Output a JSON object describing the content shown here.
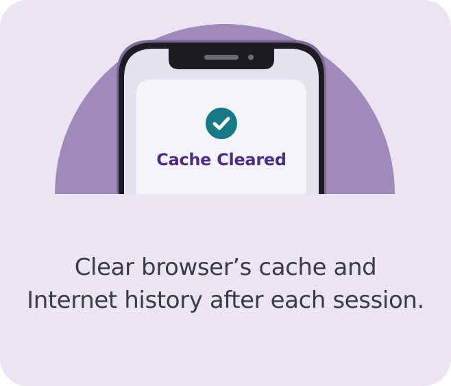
{
  "colors": {
    "card_background": "#ebe4f2",
    "semicircle": "#a089bb",
    "phone_frame": "#1c1c22",
    "phone_bezel_screen": "#e3e3f0",
    "phone_inner_screen": "#f4f5fb",
    "phone_rim": "#7d6a99",
    "check_badge": "#167a86",
    "status_text": "#4f2b85",
    "caption_text": "#3b3b40"
  },
  "icons": {
    "status_icon": "check-circle-icon"
  },
  "phone": {
    "status_label": "Cache Cleared"
  },
  "caption": {
    "line1": "Clear browser’s cache and",
    "line2": "Internet history after each session."
  }
}
